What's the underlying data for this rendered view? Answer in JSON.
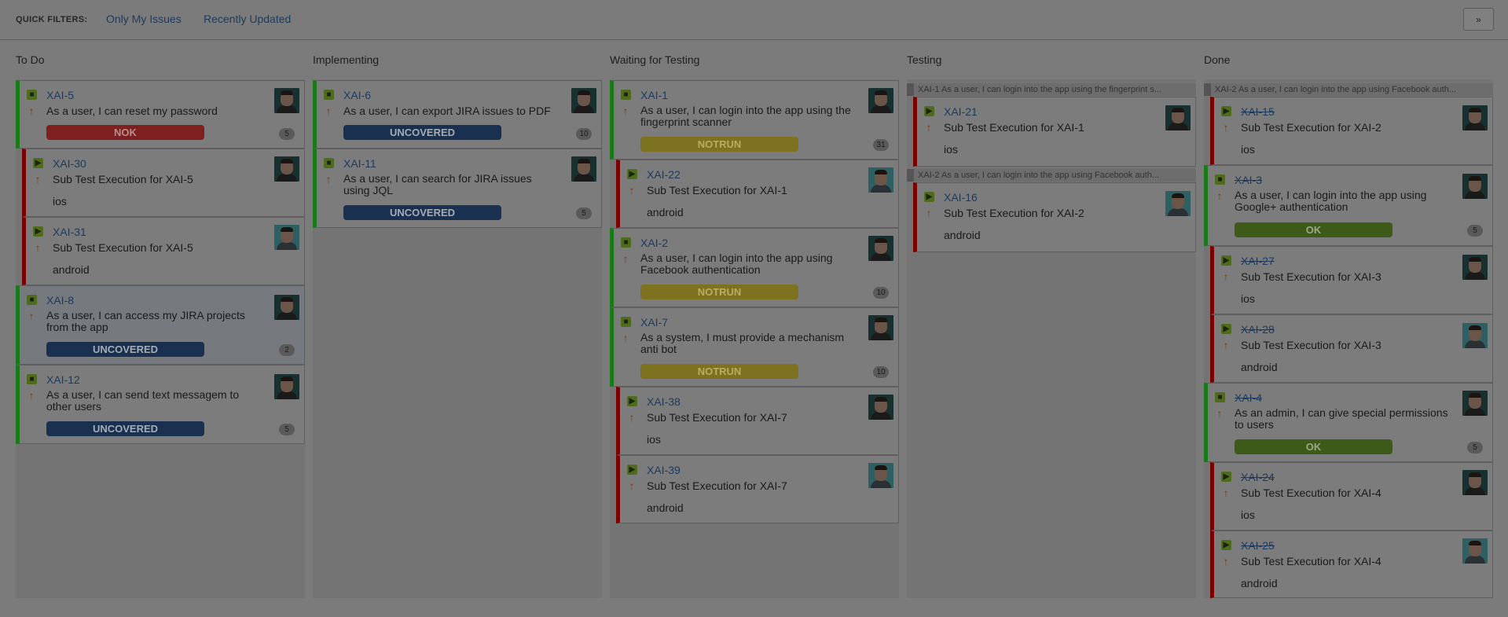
{
  "quick_filters": {
    "label": "QUICK FILTERS:",
    "only_my_issues": "Only My Issues",
    "recently_updated": "Recently Updated"
  },
  "collapse_icon": "chevron-double-down-icon",
  "columns": {
    "todo": "To Do",
    "implementing": "Implementing",
    "waiting": "Waiting for Testing",
    "testing": "Testing",
    "done": "Done"
  },
  "swimlanes": {
    "testing_1": "XAI-1   As a user, I can login into the app using the fingerprint s...",
    "testing_2": "XAI-2   As a user, I can login into the app using Facebook auth...",
    "done_1": "XAI-2   As a user, I can login into the app using Facebook auth..."
  },
  "cards": {
    "xai5": {
      "key": "XAI-5",
      "summary": "As a user, I can reset my password",
      "status": "NOK",
      "count": "5"
    },
    "xai30": {
      "key": "XAI-30",
      "summary": "Sub Test Execution for XAI-5",
      "env": "ios"
    },
    "xai31": {
      "key": "XAI-31",
      "summary": "Sub Test Execution for XAI-5",
      "env": "android"
    },
    "xai8": {
      "key": "XAI-8",
      "summary1": "As a user, I can access my JIRA projects",
      "summary2": "from the app",
      "status": "UNCOVERED",
      "count": "2"
    },
    "xai12": {
      "key": "XAI-12",
      "summary1": "As a user, I can send text messagem to",
      "summary2": "other users",
      "status": "UNCOVERED",
      "count": "5"
    },
    "xai6": {
      "key": "XAI-6",
      "summary": "As a user, I can export JIRA issues to PDF",
      "status": "UNCOVERED",
      "count": "10"
    },
    "xai11": {
      "key": "XAI-11",
      "summary1": "As a user, I can search for JIRA issues",
      "summary2": "using JQL",
      "status": "UNCOVERED",
      "count": "5"
    },
    "xai1": {
      "key": "XAI-1",
      "summary1": "As a user, I can login into the app using the",
      "summary2": "fingerprint scanner",
      "status": "NOTRUN",
      "count": "31"
    },
    "xai22": {
      "key": "XAI-22",
      "summary": "Sub Test Execution for XAI-1",
      "env": "android"
    },
    "xai2": {
      "key": "XAI-2",
      "summary1": "As a user, I can login into the app using",
      "summary2": "Facebook authentication",
      "status": "NOTRUN",
      "count": "10"
    },
    "xai7": {
      "key": "XAI-7",
      "summary1": "As a system, I must provide a mechanism",
      "summary2": "anti bot",
      "status": "NOTRUN",
      "count": "10"
    },
    "xai38": {
      "key": "XAI-38",
      "summary": "Sub Test Execution for XAI-7",
      "env": "ios"
    },
    "xai39": {
      "key": "XAI-39",
      "summary": "Sub Test Execution for XAI-7",
      "env": "android"
    },
    "xai21": {
      "key": "XAI-21",
      "summary": "Sub Test Execution for XAI-1",
      "env": "ios"
    },
    "xai16": {
      "key": "XAI-16",
      "summary": "Sub Test Execution for XAI-2",
      "env": "android"
    },
    "xai15": {
      "key": "XAI-15",
      "summary": "Sub Test Execution for XAI-2",
      "env": "ios"
    },
    "xai3": {
      "key": "XAI-3",
      "summary1": "As a user, I can login into the app using",
      "summary2": "Google+ authentication",
      "status": "OK",
      "count": "5"
    },
    "xai27": {
      "key": "XAI-27",
      "summary": "Sub Test Execution for XAI-3",
      "env": "ios"
    },
    "xai28": {
      "key": "XAI-28",
      "summary": "Sub Test Execution for XAI-3",
      "env": "android"
    },
    "xai4": {
      "key": "XAI-4",
      "summary1": "As an admin, I can give special permissions",
      "summary2": "to users",
      "status": "OK",
      "count": "5"
    },
    "xai24": {
      "key": "XAI-24",
      "summary": "Sub Test Execution for XAI-4",
      "env": "ios"
    },
    "xai25": {
      "key": "XAI-25",
      "summary": "Sub Test Execution for XAI-4",
      "env": "android"
    }
  }
}
